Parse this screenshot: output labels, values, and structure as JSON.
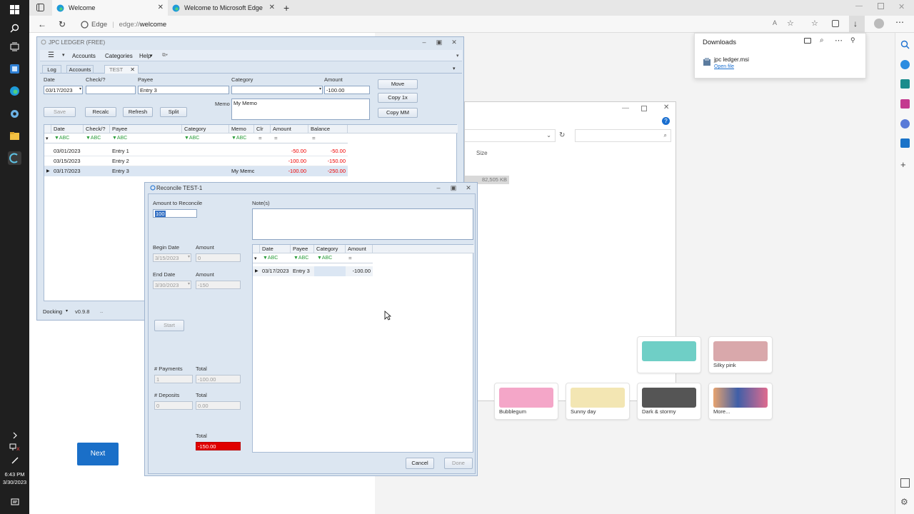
{
  "taskbar": {
    "clock_time": "6:43 PM",
    "clock_date": "3/30/2023"
  },
  "browser": {
    "tabs": [
      {
        "label": "Welcome"
      },
      {
        "label": "Welcome to Microsoft Edge"
      }
    ],
    "edge_label": "Edge",
    "url_prefix": "edge://",
    "url_rest": "welcome"
  },
  "downloads": {
    "title": "Downloads",
    "file_name": "jpc ledger.msi",
    "open_file": "Open file"
  },
  "welcome_page": {
    "next_label": "Next",
    "themes": [
      {
        "name": "Silky pink",
        "color": "#d9a8ab"
      },
      {
        "name": "Bubblegum",
        "color": "#f4a6c8"
      },
      {
        "name": "Sunny day",
        "color": "#f3e6b3"
      },
      {
        "name": "Dark & stormy",
        "color": "#555555"
      },
      {
        "name": "More...",
        "color": "#e39b7b"
      }
    ]
  },
  "explorer": {
    "size_header": "Size",
    "size_value": "82,505 KB"
  },
  "ledger": {
    "title": "JPC LEDGER (FREE)",
    "menu": [
      "Accounts",
      "Categories",
      "Help"
    ],
    "tabs": [
      "Log",
      "Accounts",
      "TEST"
    ],
    "form": {
      "date_label": "Date",
      "date_value": "03/17/2023",
      "check_label": "Check/?",
      "payee_label": "Payee",
      "payee_value": "Entry 3",
      "category_label": "Category",
      "amount_label": "Amount",
      "amount_value": "-100.00",
      "memo_label": "Memo",
      "memo_value": "My Memo"
    },
    "buttons": {
      "move": "Move",
      "copy1x": "Copy 1x",
      "copymm": "Copy MM",
      "save": "Save",
      "recalc": "Recalc",
      "refresh": "Refresh",
      "split": "Split"
    },
    "grid_headers": [
      "Date",
      "Check/?",
      "Payee",
      "Category",
      "Memo",
      "Clr",
      "Amount",
      "Balance"
    ],
    "rows": [
      {
        "date": "03/01/2023",
        "payee": "Entry 1",
        "memo": "",
        "amount": "-50.00",
        "balance": "-50.00"
      },
      {
        "date": "03/15/2023",
        "payee": "Entry 2",
        "memo": "",
        "amount": "-100.00",
        "balance": "-150.00"
      },
      {
        "date": "03/17/2023",
        "payee": "Entry 3",
        "memo": "My Memo",
        "amount": "-100.00",
        "balance": "-250.00"
      }
    ],
    "status_docking": "Docking",
    "status_version": "v0.9.8"
  },
  "reconcile": {
    "title": "Reconcile TEST-1",
    "amount_to_reconcile_label": "Amount to Reconcile",
    "amount_to_reconcile_value": "100",
    "notes_label": "Note(s)",
    "begin_date_label": "Begin Date",
    "begin_date_value": "3/15/2023",
    "begin_amount_label": "Amount",
    "begin_amount_value": "0",
    "end_date_label": "End Date",
    "end_date_value": "3/30/2023",
    "end_amount_label": "Amount",
    "end_amount_value": "-150",
    "start_label": "Start",
    "payments_label": "# Payments",
    "payments_value": "1",
    "payments_total_label": "Total",
    "payments_total_value": "-100.00",
    "deposits_label": "# Deposits",
    "deposits_value": "0",
    "deposits_total_label": "Total",
    "deposits_total_value": "0.00",
    "total_label": "Total",
    "total_value": "-150.00",
    "grid_headers": [
      "Date",
      "Payee",
      "Category",
      "Amount"
    ],
    "rows": [
      {
        "date": "03/17/2023",
        "payee": "Entry 3",
        "category": "",
        "amount": "-100.00"
      }
    ],
    "cancel_label": "Cancel",
    "done_label": "Done"
  }
}
